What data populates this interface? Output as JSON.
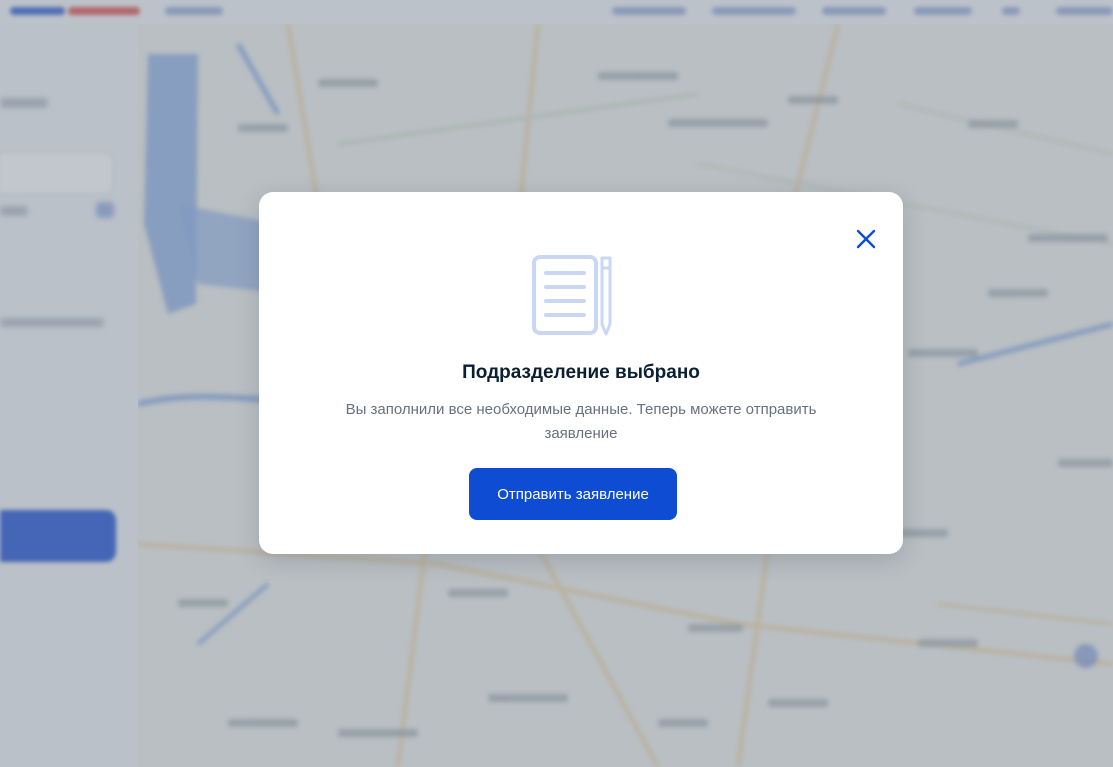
{
  "modal": {
    "title": "Подразделение выбрано",
    "message": "Вы заполнили все необходимые данные. Теперь можете отправить заявление",
    "submit_label": "Отправить заявление",
    "close_icon": "close-icon",
    "illustration_icon": "document-with-pencil-icon"
  },
  "colors": {
    "primary": "#0d4cd3",
    "title": "#0b1f33",
    "text_muted": "#66727f",
    "icon_light": "#c9d7f5",
    "overlay": "rgba(120,130,145,0.45)"
  }
}
